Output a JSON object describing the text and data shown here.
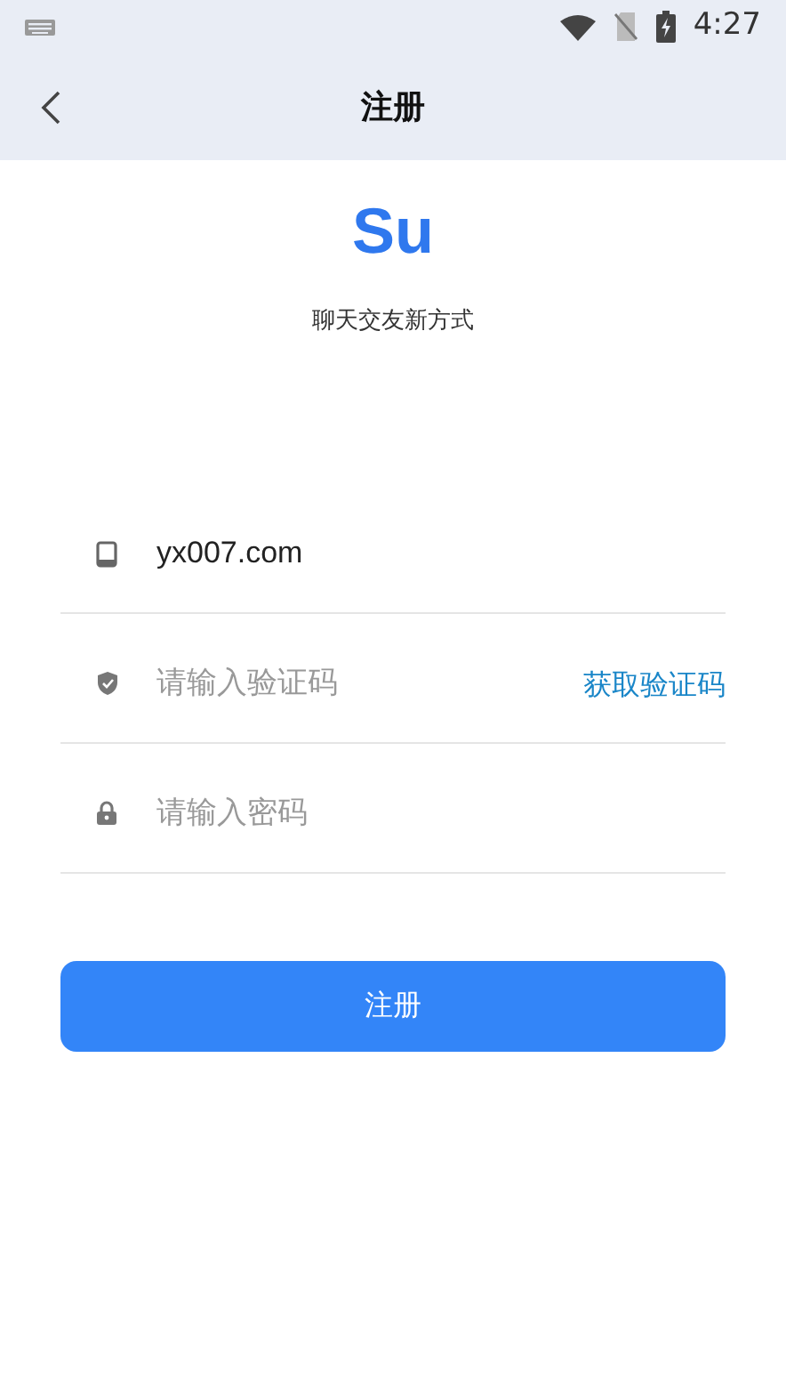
{
  "status_bar": {
    "time": "4:27"
  },
  "header": {
    "title": "注册"
  },
  "brand": {
    "logo": "Su",
    "tagline": "聊天交友新方式"
  },
  "fields": [
    {
      "kind": "phone",
      "value": "yx007.com"
    },
    {
      "kind": "code",
      "placeholder": "请输入验证码",
      "action": "获取验证码"
    },
    {
      "kind": "password",
      "placeholder": "请输入密码"
    }
  ],
  "submit": "注册"
}
